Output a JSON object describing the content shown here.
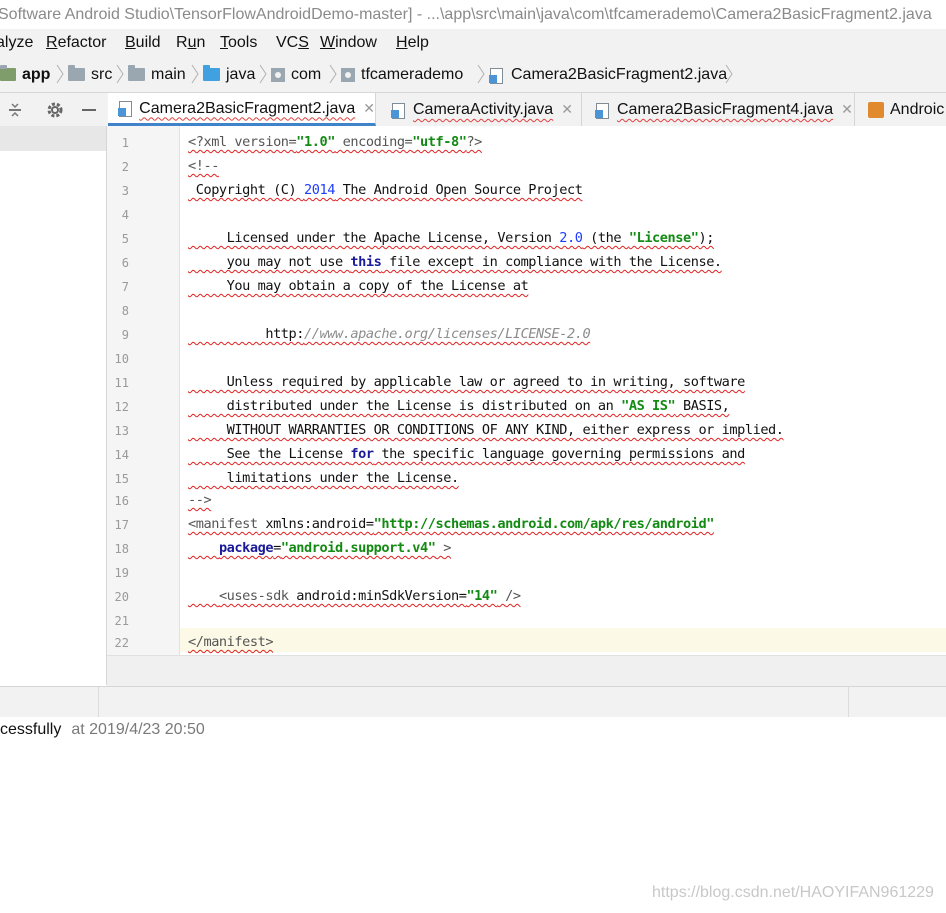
{
  "window": {
    "title": "Software Android Studio\\TensorFlowAndroidDemo-master] - ...\\app\\src\\main\\java\\com\\tfcamerademo\\Camera2BasicFragment2.java"
  },
  "menu": {
    "items": [
      {
        "pre": "",
        "mn": "",
        "post": "alyze"
      },
      {
        "pre": "",
        "mn": "R",
        "post": "efactor"
      },
      {
        "pre": "",
        "mn": "B",
        "post": "uild"
      },
      {
        "pre": "R",
        "mn": "u",
        "post": "n"
      },
      {
        "pre": "",
        "mn": "T",
        "post": "ools"
      },
      {
        "pre": "VC",
        "mn": "S",
        "post": ""
      },
      {
        "pre": "",
        "mn": "W",
        "post": "indow"
      },
      {
        "pre": "",
        "mn": "H",
        "post": "elp"
      }
    ]
  },
  "breadcrumb": {
    "items": [
      "app",
      "src",
      "main",
      "java",
      "com",
      "tfcamerademo",
      "Camera2BasicFragment2.java"
    ]
  },
  "tabs": [
    {
      "label": "Camera2BasicFragment2.java",
      "active": true
    },
    {
      "label": "CameraActivity.java",
      "active": false
    },
    {
      "label": "Camera2BasicFragment4.java",
      "active": false
    },
    {
      "label": "Androic",
      "active": false
    }
  ],
  "editor": {
    "line_numbers": [
      "1",
      "2",
      "3",
      "4",
      "5",
      "6",
      "7",
      "8",
      "9",
      "10",
      "11",
      "12",
      "13",
      "14",
      "15",
      "16",
      "17",
      "18",
      "19",
      "20",
      "21",
      "22"
    ],
    "current_line": 22
  },
  "status": {
    "message": "ccessfully",
    "time": "at 2019/4/23 20:50"
  },
  "watermark": "https://blog.csdn.net/HAOYIFAN961229",
  "colors": {
    "string": "#138a13",
    "keyword": "#1a1a9a",
    "number": "#1f3cff",
    "error_squiggle": "#e02020",
    "active_tab_underline": "#4083c9",
    "current_line": "#fcfae6"
  }
}
